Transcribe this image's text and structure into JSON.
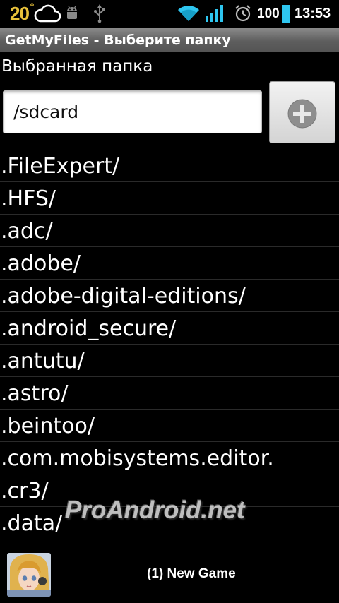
{
  "status_bar": {
    "temperature": "20",
    "temperature_unit": "°",
    "battery": "100",
    "time": "13:53",
    "icons": [
      "weather-cloud-icon",
      "android-debug-icon",
      "usb-icon",
      "wifi-icon",
      "signal-icon",
      "alarm-icon",
      "battery-icon"
    ]
  },
  "app": {
    "title": "GetMyFiles - Выберите папку"
  },
  "selector": {
    "label": "Выбранная папка",
    "path_value": "/sdcard",
    "add_icon": "plus-circle-icon"
  },
  "folders": [
    ".FileExpert/",
    ".HFS/",
    ".adc/",
    ".adobe/",
    ".adobe-digital-editions/",
    ".android_secure/",
    ".antutu/",
    ".astro/",
    ".beintoo/",
    ".com.mobisystems.editor.",
    ".cr3/",
    ".data/"
  ],
  "watermark": "ProAndroid.net",
  "ad": {
    "text": "(1) New Game"
  },
  "colors": {
    "background": "#000000",
    "temperature": "#e8c13a",
    "wifi": "#2ec6f0",
    "signal": "#2ec6f0",
    "battery": "#2ec6f0"
  }
}
